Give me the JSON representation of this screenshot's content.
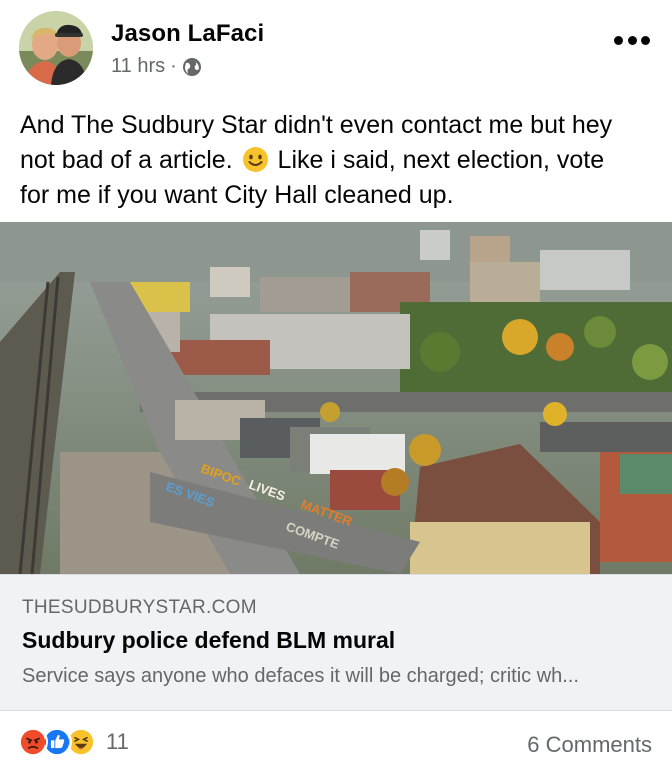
{
  "post": {
    "author": "Jason LaFaci",
    "time": "11 hrs",
    "separator": "·",
    "privacy_icon": "globe-icon",
    "text_line1": "And The Sudbury Star didn't even contact me but hey",
    "text_line2a": "not bad of a article.",
    "text_line2b": " Like i said, next election, vote",
    "text_line3": "for me if you want City Hall cleaned up.",
    "inline_emoji": "smiling-face-emoji"
  },
  "mural": {
    "word1": "BIPOC",
    "word2": "LIVES",
    "word3": "MATTER",
    "word4": "COMPTE",
    "word5": "ES VIES"
  },
  "link_preview": {
    "domain": "THESUDBURYSTAR.COM",
    "headline": "Sudbury police defend BLM mural",
    "description": "Service says anyone who defaces it will be charged; critic wh..."
  },
  "footer": {
    "reaction_icons": [
      "angry-reaction-icon",
      "like-reaction-icon",
      "haha-reaction-icon"
    ],
    "reaction_count": "11",
    "comments": "6 Comments"
  },
  "colors": {
    "text": "#050505",
    "secondary": "#65676b",
    "preview_bg": "#f0f2f5",
    "like_blue": "#1877f2",
    "angry_orange": "#f04b2a",
    "haha_yellow": "#f7c22b"
  }
}
